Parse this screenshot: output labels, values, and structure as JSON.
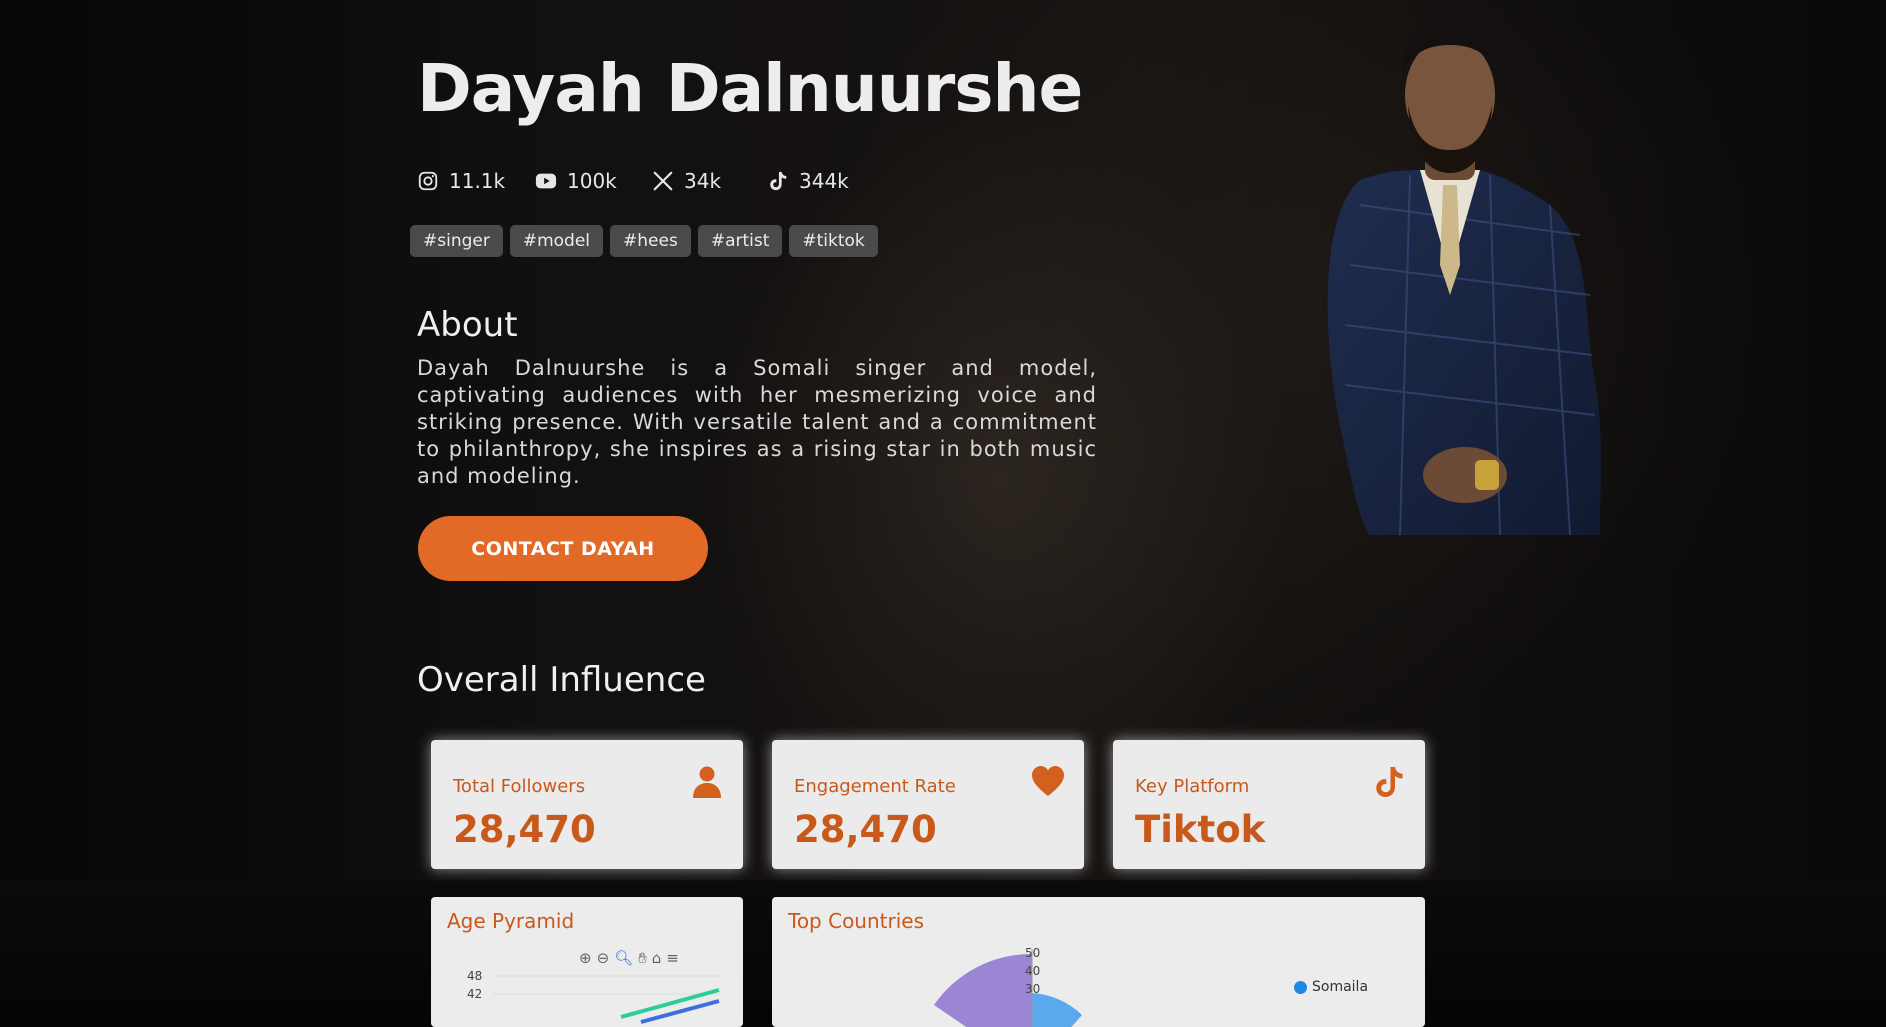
{
  "profile": {
    "name": "Dayah Dalnuurshe",
    "cta_label": "CONTACT DAYAH"
  },
  "social": [
    {
      "platform": "instagram-icon",
      "count": "11.1k"
    },
    {
      "platform": "youtube-icon",
      "count": "100k"
    },
    {
      "platform": "x-icon",
      "count": "34k"
    },
    {
      "platform": "tiktok-icon",
      "count": "344k"
    }
  ],
  "tags": [
    "#singer",
    "#model",
    "#hees",
    "#artist",
    "#tiktok"
  ],
  "about": {
    "heading": "About",
    "text": "Dayah Dalnuurshe is a Somali singer and model, captivating audiences with her mesmerizing voice and striking presence. With versatile talent and a commitment to philanthropy, she inspires as a rising star in both music and modeling."
  },
  "influence": {
    "heading": "Overall Influence",
    "cards": [
      {
        "label": "Total Followers",
        "value": "28,470",
        "icon": "person-icon"
      },
      {
        "label": "Engagement Rate",
        "value": "28,470",
        "icon": "heart-icon"
      },
      {
        "label": "Key Platform",
        "value": "Tiktok",
        "icon": "tiktok-icon"
      }
    ]
  },
  "panels": {
    "age": {
      "title": "Age Pyramid",
      "ticks": [
        "48",
        "42"
      ]
    },
    "countries": {
      "title": "Top Countries",
      "ticks": [
        "50",
        "40",
        "30"
      ],
      "legend": [
        "Somaila"
      ]
    }
  },
  "colors": {
    "accent": "#e36a26",
    "card_text": "#c9591b",
    "chart_green": "#2ecc9a",
    "chart_blue": "#3d6fe0",
    "pie_purple": "#9b86d6",
    "pie_blue": "#5aa9ef"
  }
}
